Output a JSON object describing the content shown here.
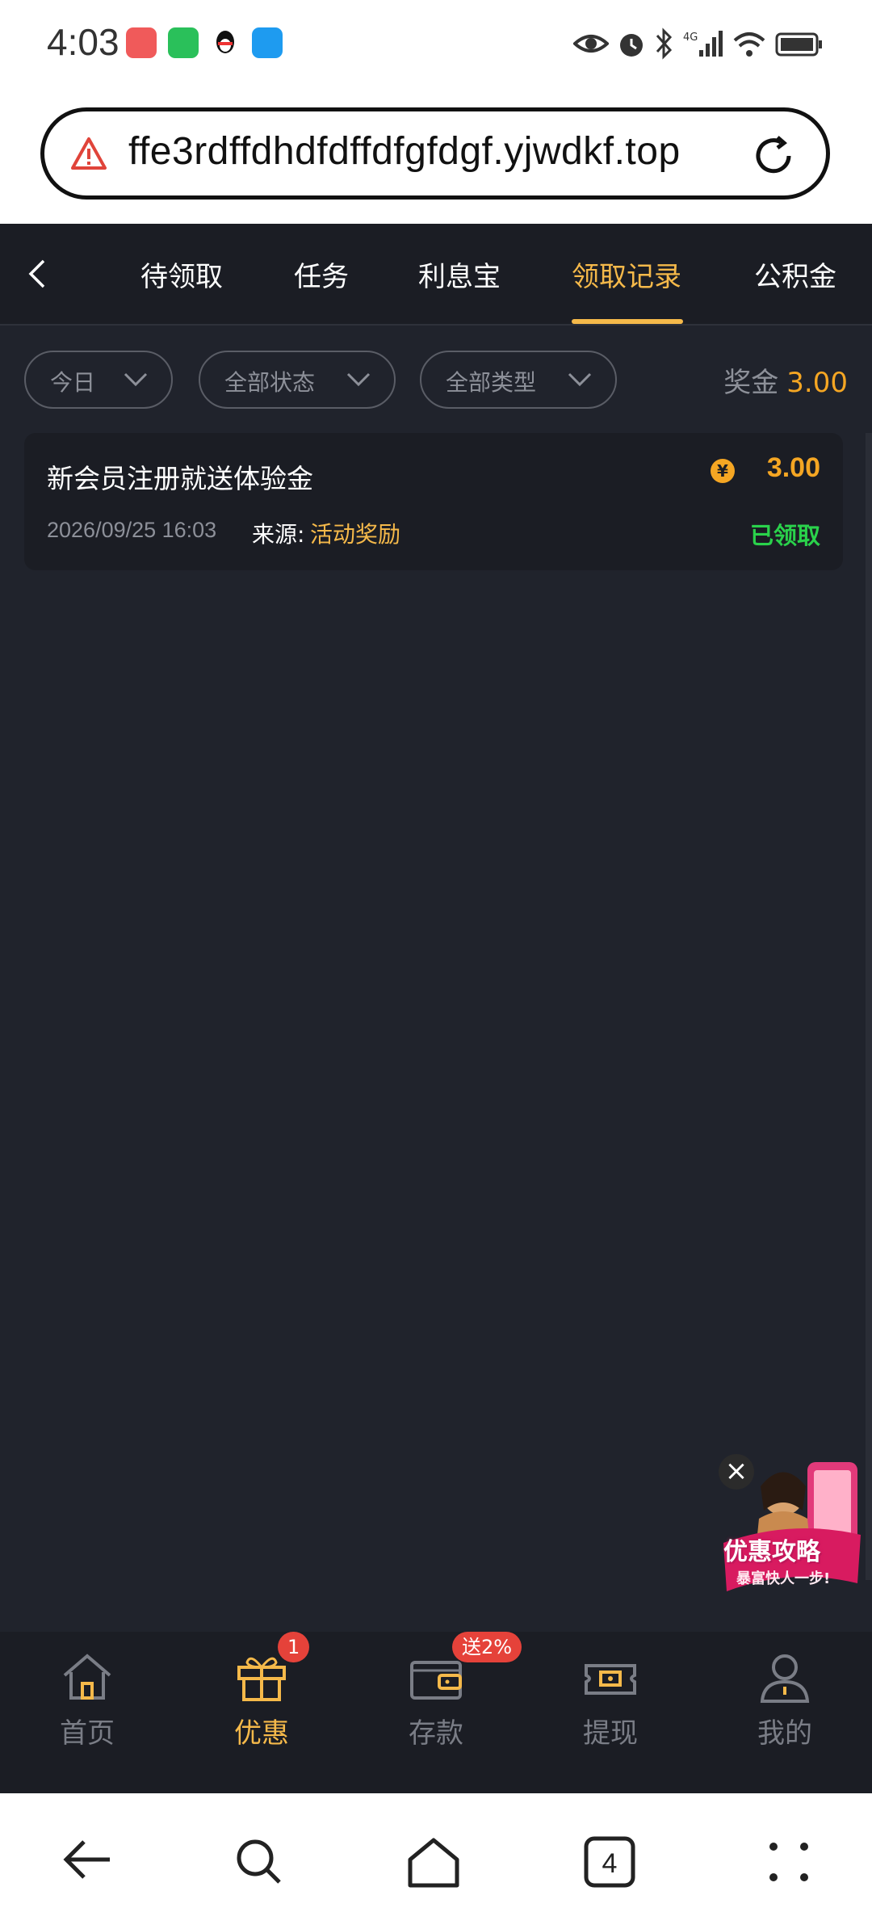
{
  "status_bar": {
    "time": "4:03",
    "network": "4G"
  },
  "browser": {
    "url": "ffe3rdffdhdfdffdfgfdgf.yjwdkf.top",
    "tab_count": "4"
  },
  "tabs": [
    {
      "label": "待领取",
      "active": false
    },
    {
      "label": "任务",
      "active": false
    },
    {
      "label": "利息宝",
      "active": false
    },
    {
      "label": "领取记录",
      "active": true
    },
    {
      "label": "公积金",
      "active": false
    }
  ],
  "filters": {
    "date": "今日",
    "status": "全部状态",
    "type": "全部类型",
    "bonus_label": "奖金",
    "bonus_value": "3.00"
  },
  "records": [
    {
      "title": "新会员注册就送体验金",
      "datetime": "2026/09/25 16:03",
      "source_label": "来源:",
      "source_value": "活动奖励",
      "amount": "3.00",
      "currency_symbol": "¥",
      "status": "已领取"
    }
  ],
  "promo": {
    "title": "优惠攻略",
    "subtitle": "暴富快人一步!",
    "close": "×"
  },
  "bottom_nav": [
    {
      "label": "首页",
      "icon": "home-icon"
    },
    {
      "label": "优惠",
      "icon": "gift-icon",
      "badge": "1",
      "active": true
    },
    {
      "label": "存款",
      "icon": "wallet-icon",
      "badge": "送2%"
    },
    {
      "label": "提现",
      "icon": "withdraw-icon"
    },
    {
      "label": "我的",
      "icon": "user-icon"
    }
  ],
  "colors": {
    "accent": "#f5b94a",
    "amount": "#f5a623",
    "success": "#2ad24b",
    "background": "#20232c",
    "badge": "#e5423a"
  }
}
